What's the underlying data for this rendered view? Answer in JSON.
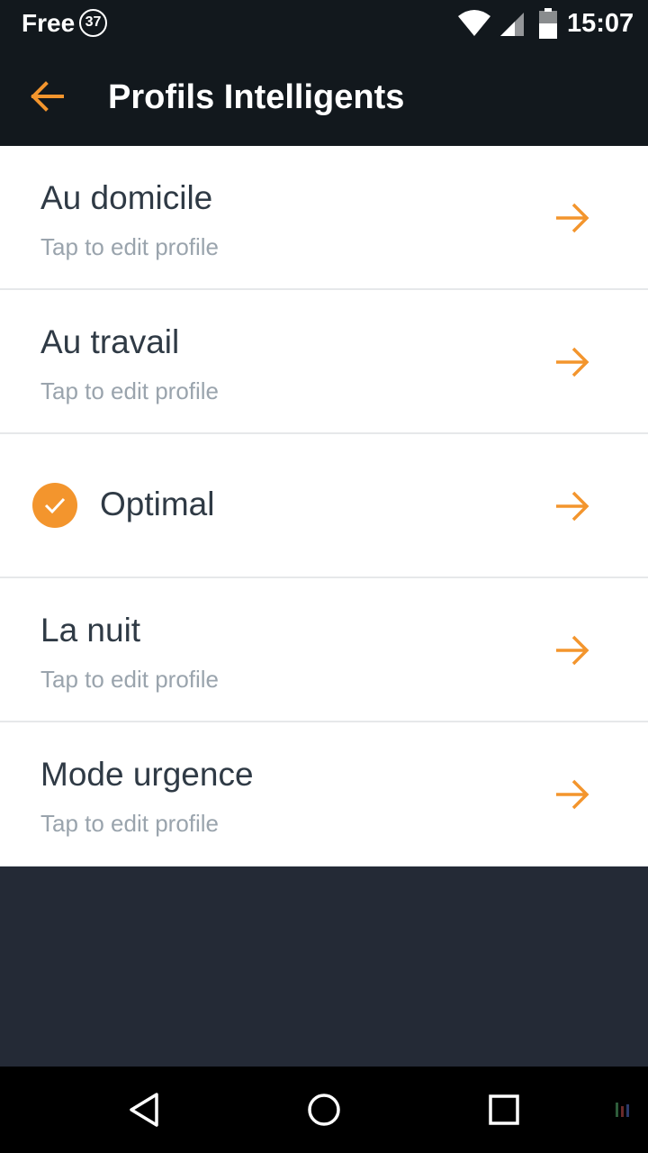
{
  "status_bar": {
    "carrier": "Free",
    "notification_count": "37",
    "time": "15:07",
    "icons": [
      "wifi-icon",
      "cell-signal-icon",
      "battery-icon"
    ]
  },
  "app_bar": {
    "title": "Profils Intelligents",
    "back_icon": "arrow-left-icon"
  },
  "profiles": [
    {
      "name": "Au domicile",
      "subtitle": "Tap to edit profile",
      "active": false
    },
    {
      "name": "Au travail",
      "subtitle": "Tap to edit profile",
      "active": false
    },
    {
      "name": "Optimal",
      "subtitle": "",
      "active": true
    },
    {
      "name": "La nuit",
      "subtitle": "Tap to edit profile",
      "active": false
    },
    {
      "name": "Mode urgence",
      "subtitle": "Tap to edit profile",
      "active": false
    }
  ],
  "nav_bar": {
    "icons": [
      "back-triangle-icon",
      "home-circle-icon",
      "recents-square-icon"
    ]
  },
  "colors": {
    "accent": "#f3952d",
    "header_bg": "#12181d",
    "body_bg": "#242a36",
    "text_primary": "#2f3a45",
    "text_secondary": "#9aa4ad"
  }
}
